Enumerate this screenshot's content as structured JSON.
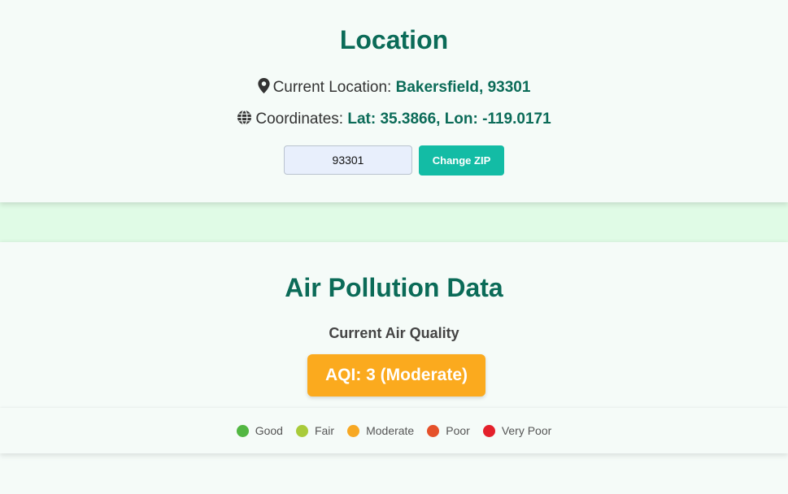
{
  "location": {
    "title": "Location",
    "city_label": "Current Location:",
    "city_value": "Bakersfield, 93301",
    "coords_label": "Coordinates:",
    "coords_value": "Lat: 35.3866, Lon: -119.0171",
    "zip_input_value": "93301",
    "change_zip_label": "Change ZIP",
    "icons": {
      "city": "map-marker-icon",
      "coords": "globe-icon"
    }
  },
  "pollution": {
    "title": "Air Pollution Data",
    "subtitle": "Current Air Quality",
    "aqi_text": "AQI: 3 (Moderate)",
    "aqi_color": "#fbaa1e",
    "legend": [
      {
        "label": "Good",
        "color": "#52b742"
      },
      {
        "label": "Fair",
        "color": "#a9cb3a"
      },
      {
        "label": "Moderate",
        "color": "#f7a823"
      },
      {
        "label": "Poor",
        "color": "#e5512a"
      },
      {
        "label": "Very Poor",
        "color": "#e4202b"
      }
    ]
  },
  "colors": {
    "accent": "#0b6b58",
    "button": "#13bca5",
    "background": "#e0fbe6",
    "card": "#f5fbf8"
  }
}
